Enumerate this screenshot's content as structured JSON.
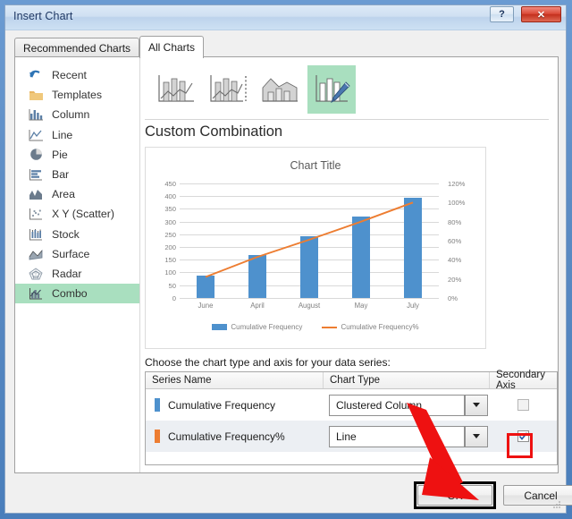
{
  "window": {
    "title": "Insert Chart",
    "help_button": "?",
    "close_button": "✕"
  },
  "tabs": [
    {
      "label": "Recommended Charts",
      "active": false
    },
    {
      "label": "All Charts",
      "active": true
    }
  ],
  "sidebar": {
    "items": [
      {
        "label": "Recent",
        "icon": "recent-icon",
        "selected": false
      },
      {
        "label": "Templates",
        "icon": "templates-folder-icon",
        "selected": false
      },
      {
        "label": "Column",
        "icon": "column-chart-icon",
        "selected": false
      },
      {
        "label": "Line",
        "icon": "line-chart-icon",
        "selected": false
      },
      {
        "label": "Pie",
        "icon": "pie-chart-icon",
        "selected": false
      },
      {
        "label": "Bar",
        "icon": "bar-chart-icon",
        "selected": false
      },
      {
        "label": "Area",
        "icon": "area-chart-icon",
        "selected": false
      },
      {
        "label": "X Y (Scatter)",
        "icon": "scatter-chart-icon",
        "selected": false
      },
      {
        "label": "Stock",
        "icon": "stock-chart-icon",
        "selected": false
      },
      {
        "label": "Surface",
        "icon": "surface-chart-icon",
        "selected": false
      },
      {
        "label": "Radar",
        "icon": "radar-chart-icon",
        "selected": false
      },
      {
        "label": "Combo",
        "icon": "combo-chart-icon",
        "selected": true
      }
    ]
  },
  "thumbnails": [
    {
      "name": "clustered-column-line",
      "selected": false
    },
    {
      "name": "clustered-column-line-on-secondary-axis",
      "selected": false
    },
    {
      "name": "stacked-area-clustered-column",
      "selected": false
    },
    {
      "name": "custom-combination",
      "selected": true
    }
  ],
  "preview": {
    "heading": "Custom Combination"
  },
  "chart_data": {
    "type": "bar",
    "title": "Chart Title",
    "categories": [
      "June",
      "April",
      "August",
      "May",
      "July"
    ],
    "series": [
      {
        "name": "Cumulative Frequency",
        "type": "bar",
        "axis": "primary",
        "color": "#4e91cd",
        "values": [
          88,
          168,
          243,
          320,
          395
        ]
      },
      {
        "name": "Cumulative Frequency%",
        "type": "line",
        "axis": "secondary",
        "color": "#ed7d31",
        "values": [
          22,
          43,
          61,
          80,
          100
        ]
      }
    ],
    "xlabel": "",
    "ylabel": "",
    "ylim": [
      0,
      450
    ],
    "y_ticks": [
      0,
      50,
      100,
      150,
      200,
      250,
      300,
      350,
      400,
      450
    ],
    "y2lim": [
      0,
      120
    ],
    "y2_ticks": [
      "0%",
      "20%",
      "40%",
      "60%",
      "80%",
      "100%",
      "120%"
    ],
    "grid": true,
    "legend": [
      "Cumulative Frequency",
      "Cumulative Frequency%"
    ],
    "legend_position": "bottom"
  },
  "series_panel": {
    "caption": "Choose the chart type and axis for your data series:",
    "headers": {
      "series_name": "Series Name",
      "chart_type": "Chart Type",
      "secondary_axis": "Secondary Axis"
    },
    "rows": [
      {
        "series_name": "Cumulative Frequency",
        "color": "#4e91cd",
        "chart_type": "Clustered Column",
        "secondary_axis_checked": false,
        "highlighted": false
      },
      {
        "series_name": "Cumulative Frequency%",
        "color": "#ed7d31",
        "chart_type": "Line",
        "secondary_axis_checked": true,
        "highlighted": true
      }
    ]
  },
  "footer": {
    "ok_label": "OK",
    "cancel_label": "Cancel"
  },
  "annotations": {
    "arrow_color": "#ee1111",
    "highlight_color": "#ee1111",
    "emphasis_color": "#000000"
  }
}
